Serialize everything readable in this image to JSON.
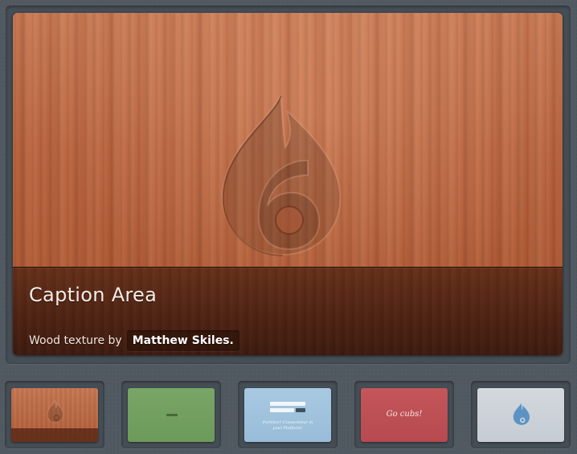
{
  "slide": {
    "caption_title": "Caption Area",
    "caption_text": "Wood texture by",
    "caption_link": "Matthew Skiles.",
    "logo_icon": "drop-6-logo-icon"
  },
  "thumbnails": [
    {
      "name": "wood",
      "color": "#b9653f",
      "icon": "drop-6-logo-icon"
    },
    {
      "name": "green",
      "color": "#6f9c5d"
    },
    {
      "name": "blue",
      "color": "#9fc2dd",
      "text": "Porttitor! Consectetur in your Platform!"
    },
    {
      "name": "red",
      "color": "#bd5055",
      "text": "Go cubs!"
    },
    {
      "name": "grey",
      "color": "#ccd1d7",
      "icon": "drop-6-logo-icon",
      "icon_color": "#5b93c4"
    }
  ],
  "colors": {
    "background": "#4f5860",
    "frame": "#454d55",
    "caption_overlay": "#4a2012"
  }
}
